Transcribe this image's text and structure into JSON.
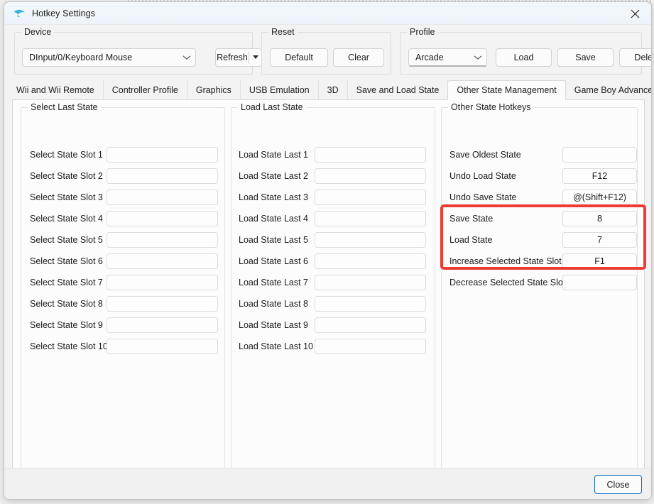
{
  "window": {
    "title": "Hotkey Settings",
    "app_icon": "dolphin-icon",
    "close_icon": "close-icon"
  },
  "device_group": {
    "title": "Device",
    "selected_device": "DInput/0/Keyboard Mouse",
    "refresh_label": "Refresh"
  },
  "reset_group": {
    "title": "Reset",
    "default_label": "Default",
    "clear_label": "Clear"
  },
  "profile_group": {
    "title": "Profile",
    "selected_profile": "Arcade",
    "load_label": "Load",
    "save_label": "Save",
    "delete_label": "Delete"
  },
  "tabs": {
    "items": [
      {
        "label": "Wii and Wii Remote",
        "active": false
      },
      {
        "label": "Controller Profile",
        "active": false
      },
      {
        "label": "Graphics",
        "active": false
      },
      {
        "label": "USB Emulation",
        "active": false
      },
      {
        "label": "3D",
        "active": false
      },
      {
        "label": "Save and Load State",
        "active": false
      },
      {
        "label": "Other State Management",
        "active": true
      },
      {
        "label": "Game Boy Advance",
        "active": false
      }
    ],
    "scroll_left_icon": "triangle-left-icon",
    "scroll_right_icon": "triangle-right-icon"
  },
  "select_last_state": {
    "title": "Select Last State",
    "rows": [
      {
        "label": "Select State Slot 1",
        "value": ""
      },
      {
        "label": "Select State Slot 2",
        "value": ""
      },
      {
        "label": "Select State Slot 3",
        "value": ""
      },
      {
        "label": "Select State Slot 4",
        "value": ""
      },
      {
        "label": "Select State Slot 5",
        "value": ""
      },
      {
        "label": "Select State Slot 6",
        "value": ""
      },
      {
        "label": "Select State Slot 7",
        "value": ""
      },
      {
        "label": "Select State Slot 8",
        "value": ""
      },
      {
        "label": "Select State Slot 9",
        "value": ""
      },
      {
        "label": "Select State Slot 10",
        "value": ""
      }
    ]
  },
  "load_last_state": {
    "title": "Load Last State",
    "rows": [
      {
        "label": "Load State Last 1",
        "value": ""
      },
      {
        "label": "Load State Last 2",
        "value": ""
      },
      {
        "label": "Load State Last 3",
        "value": ""
      },
      {
        "label": "Load State Last 4",
        "value": ""
      },
      {
        "label": "Load State Last 5",
        "value": ""
      },
      {
        "label": "Load State Last 6",
        "value": ""
      },
      {
        "label": "Load State Last 7",
        "value": ""
      },
      {
        "label": "Load State Last 8",
        "value": ""
      },
      {
        "label": "Load State Last 9",
        "value": ""
      },
      {
        "label": "Load State Last 10",
        "value": ""
      }
    ]
  },
  "other_state_hotkeys": {
    "title": "Other State Hotkeys",
    "rows": [
      {
        "label": "Save Oldest State",
        "value": ""
      },
      {
        "label": "Undo Load State",
        "value": "F12"
      },
      {
        "label": "Undo Save State",
        "value": "@(Shift+F12)"
      },
      {
        "label": "Save State",
        "value": "8"
      },
      {
        "label": "Load State",
        "value": "7"
      },
      {
        "label": "Increase Selected State Slot",
        "value": "F1"
      },
      {
        "label": "Decrease Selected State Slot",
        "value": ""
      }
    ]
  },
  "highlight": {
    "color": "#ee3b33",
    "covers": [
      "Save State",
      "Load State",
      "Increase Selected State Slot"
    ]
  },
  "footer": {
    "close_label": "Close"
  },
  "colors": {
    "accent": "#0f6cbd",
    "window_bg": "#f3f3f3",
    "panel_bg": "#fcfcfc",
    "highlight_red": "#ee3b33"
  }
}
